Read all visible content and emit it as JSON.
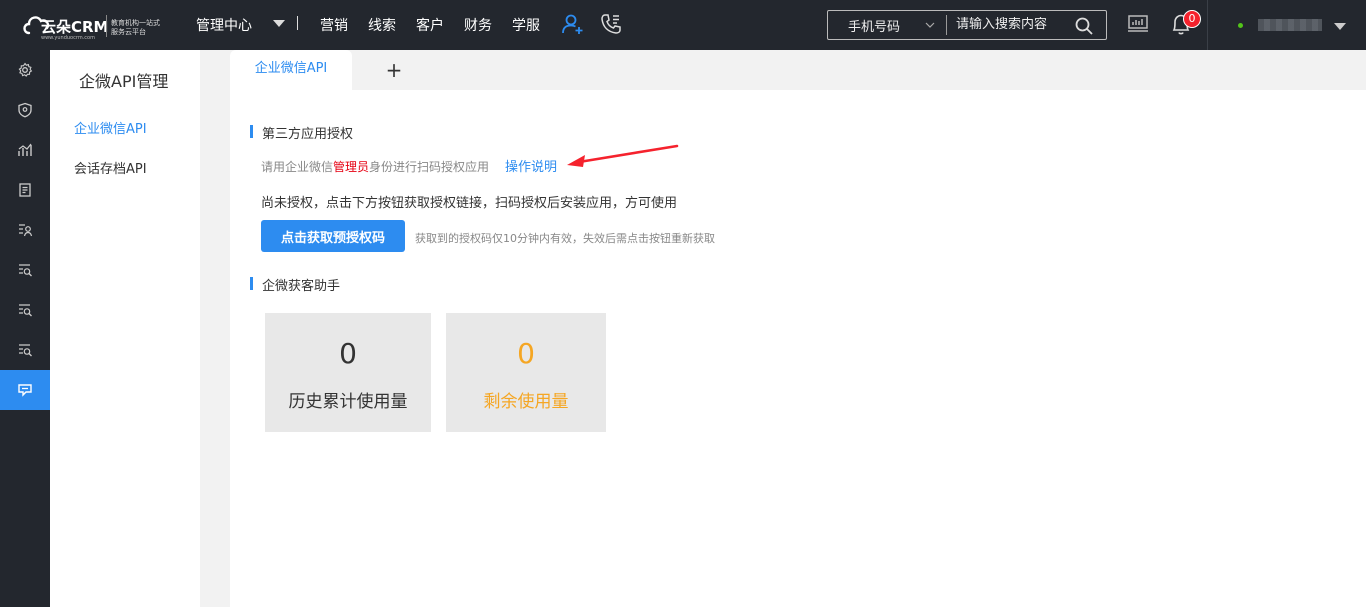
{
  "header": {
    "logo": {
      "brand": "云朵CRM",
      "url": "www.yunduocrm.com",
      "slogan": "教育机构一站式服务云平台"
    },
    "mgmt_label": "管理中心",
    "nav": [
      {
        "label": "营销"
      },
      {
        "label": "线索"
      },
      {
        "label": "客户"
      },
      {
        "label": "财务"
      },
      {
        "label": "学服"
      }
    ],
    "nav_icons": [
      "add-user-icon",
      "phone-icon"
    ],
    "search": {
      "type_label": "手机号码",
      "placeholder": "请输入搜索内容"
    },
    "notifications_count": "0"
  },
  "rail": {
    "icons": [
      "gear-icon",
      "shield-icon",
      "chart-icon",
      "document-icon",
      "user-list-icon",
      "search-list-icon",
      "search-list-icon",
      "search-list-icon",
      "wechat-api-icon"
    ],
    "active_index": 8
  },
  "submenu": {
    "title": "企微API管理",
    "items": [
      {
        "label": "企业微信API",
        "active": true
      },
      {
        "label": "会话存档API",
        "active": false
      }
    ]
  },
  "tabs": {
    "items": [
      {
        "label": "企业微信API"
      }
    ]
  },
  "main": {
    "section1": {
      "title": "第三方应用授权",
      "hint_prefix": "请用企业微信",
      "hint_highlight": "管理员",
      "hint_suffix": "身份进行扫码授权应用",
      "guide_link": "操作说明",
      "notice": "尚未授权，点击下方按钮获取授权链接，扫码授权后安装应用，方可使用",
      "button_label": "点击获取预授权码",
      "button_hint": "获取到的授权码仅10分钟内有效，失效后需点击按钮重新获取"
    },
    "section2": {
      "title": "企微获客助手",
      "cards": [
        {
          "value": "0",
          "label": "历史累计使用量",
          "color": "#333333"
        },
        {
          "value": "0",
          "label": "剩余使用量",
          "color": "#f5a623"
        }
      ]
    }
  },
  "colors": {
    "accent": "#2d8cf0",
    "topbar": "#23272e",
    "highlight_red": "#e60012",
    "arrow_red": "#f5222d",
    "remaining": "#f5a623"
  }
}
